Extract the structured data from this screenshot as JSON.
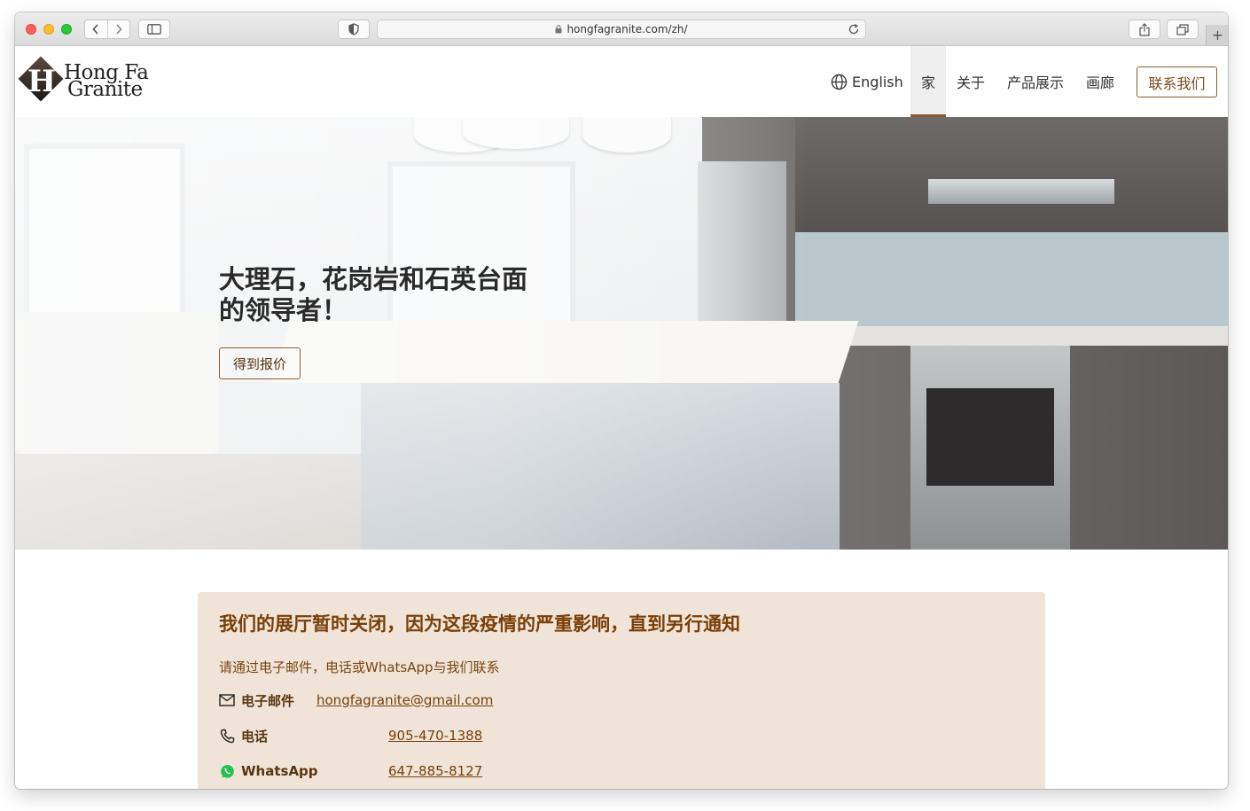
{
  "browser": {
    "url": "hongfagranite.com/zh/",
    "new_tab_label": "+"
  },
  "logo": {
    "mark": "H",
    "line1": "Hong Fa",
    "line2": "Granite"
  },
  "nav": {
    "language": "English",
    "home": "家",
    "about": "关于",
    "products": "产品展示",
    "gallery": "画廊",
    "contact": "联系我们"
  },
  "hero": {
    "title_line1": "大理石，花岗岩和石英台面",
    "title_line2": "的领导者！",
    "cta": "得到报价"
  },
  "notice": {
    "title": "我们的展厅暂时关闭，因为这段疫情的严重影响，直到另行通知",
    "subtitle": "请通过电子邮件，电话或WhatsApp与我们联系",
    "contacts": [
      {
        "label": "电子邮件",
        "value": "hongfagranite@gmail.com"
      },
      {
        "label": "电话",
        "value": "905-470-1388"
      },
      {
        "label": "WhatsApp",
        "value": "647-885-8127"
      }
    ]
  },
  "colors": {
    "accent": "#8a5d2f",
    "notice_bg": "#efe4d7",
    "notice_title": "#7a3f08"
  }
}
